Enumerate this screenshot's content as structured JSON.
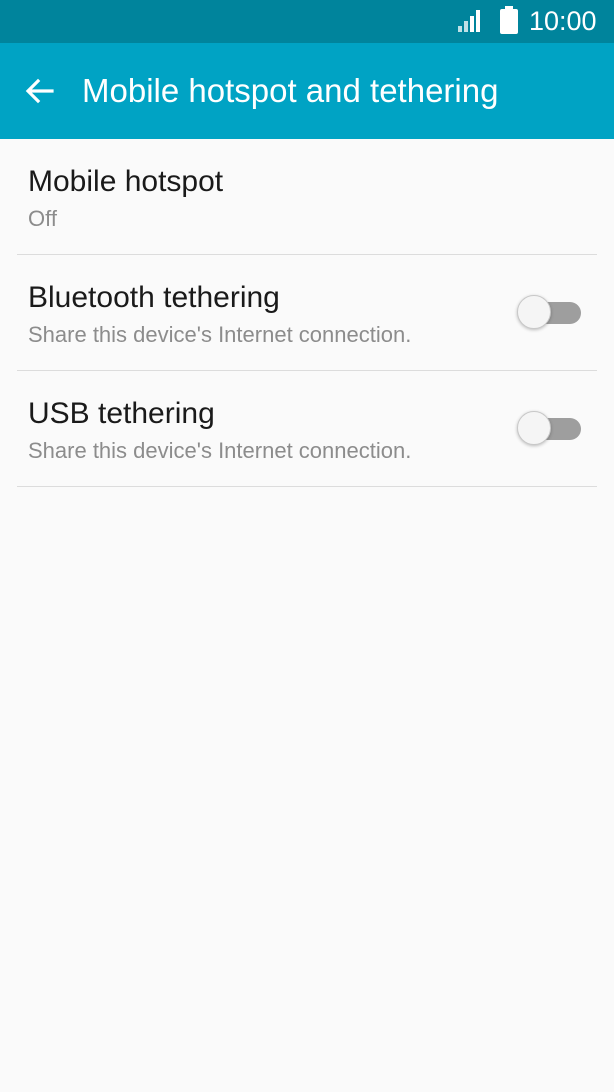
{
  "status_bar": {
    "time": "10:00",
    "icons": [
      "signal-icon",
      "battery-icon"
    ]
  },
  "app_bar": {
    "back_icon": "arrow-left-icon",
    "title": "Mobile hotspot and tethering"
  },
  "settings": [
    {
      "title": "Mobile hotspot",
      "summary": "Off"
    },
    {
      "title": "Bluetooth tethering",
      "summary": "Share this device's Internet connection.",
      "toggle": "off"
    },
    {
      "title": "USB tethering",
      "summary": "Share this device's Internet connection.",
      "toggle": "off"
    }
  ],
  "colors": {
    "status_bar": "#00849c",
    "app_bar": "#00a3c4",
    "background": "#fafafa"
  }
}
